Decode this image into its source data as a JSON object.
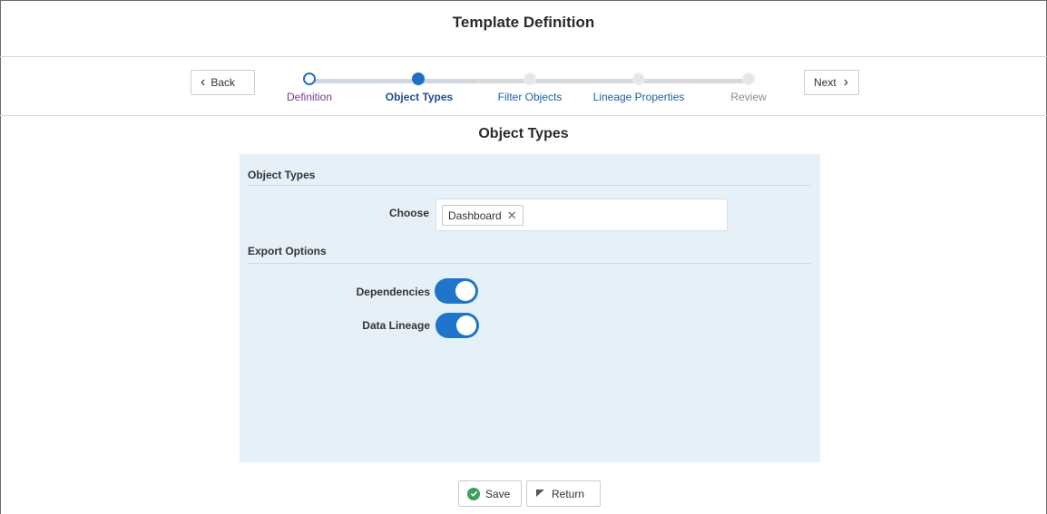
{
  "header": {
    "title": "Template Definition"
  },
  "train": {
    "back_label": "Back",
    "next_label": "Next",
    "stops": [
      {
        "label": "Definition",
        "state": "visited"
      },
      {
        "label": "Object Types",
        "state": "current"
      },
      {
        "label": "Filter Objects",
        "state": "unvisited"
      },
      {
        "label": "Lineage Properties",
        "state": "unvisited"
      },
      {
        "label": "Review",
        "state": "disabled"
      }
    ]
  },
  "main": {
    "section_title": "Object Types",
    "object_types": {
      "heading": "Object Types",
      "choose_label": "Choose",
      "selected": [
        "Dashboard"
      ]
    },
    "export_options": {
      "heading": "Export Options",
      "dependencies_label": "Dependencies",
      "dependencies_on": true,
      "lineage_label": "Data Lineage",
      "lineage_on": true
    }
  },
  "footer": {
    "save_label": "Save",
    "return_label": "Return"
  },
  "colors": {
    "accent": "#1f75cb",
    "panel": "#e6f0f9",
    "save_icon": "#3aa05a"
  },
  "icons": [
    "chevron-left-icon",
    "chevron-right-icon",
    "remove-icon",
    "check-circle-icon",
    "return-icon"
  ]
}
